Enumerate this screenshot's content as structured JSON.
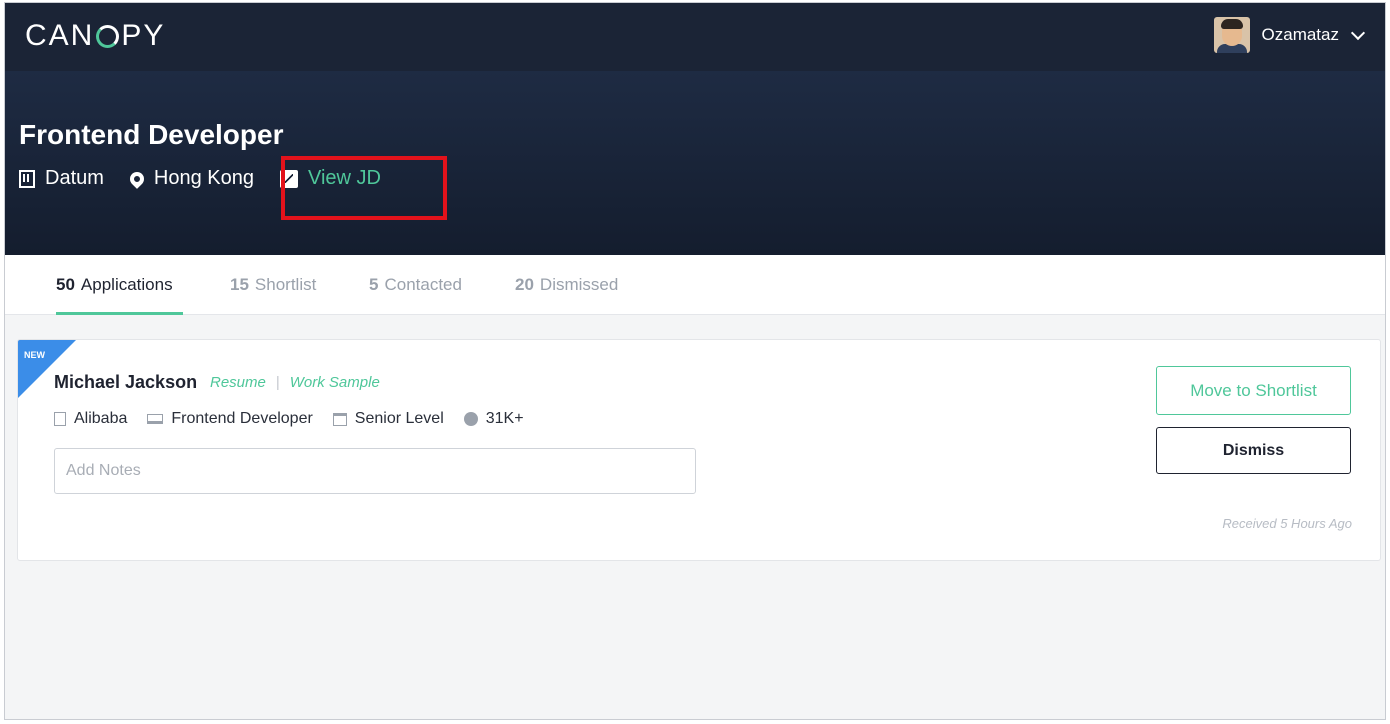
{
  "app": {
    "logo_prefix": "CAN",
    "logo_suffix": "PY"
  },
  "user": {
    "name": "Ozamataz"
  },
  "job": {
    "title": "Frontend Developer",
    "company": "Datum",
    "location": "Hong Kong",
    "view_jd_label": "View JD"
  },
  "tabs": [
    {
      "count": "50",
      "label": "Applications",
      "active": true
    },
    {
      "count": "15",
      "label": "Shortlist",
      "active": false
    },
    {
      "count": "5",
      "label": "Contacted",
      "active": false
    },
    {
      "count": "20",
      "label": "Dismissed",
      "active": false
    }
  ],
  "candidate": {
    "badge": "NEW",
    "name": "Michael Jackson",
    "resume_label": "Resume",
    "work_sample_label": "Work Sample",
    "separator": "|",
    "company": "Alibaba",
    "role": "Frontend Developer",
    "level": "Senior Level",
    "salary": "31K+",
    "notes_placeholder": "Add Notes",
    "notes_value": "",
    "received": "Received 5 Hours Ago"
  },
  "actions": {
    "shortlist_label": "Move to Shortlist",
    "dismiss_label": "Dismiss"
  },
  "colors": {
    "accent": "#4fc79a",
    "navbar": "#1b2436",
    "highlight": "#e3121b",
    "ribbon": "#3b8de8"
  }
}
